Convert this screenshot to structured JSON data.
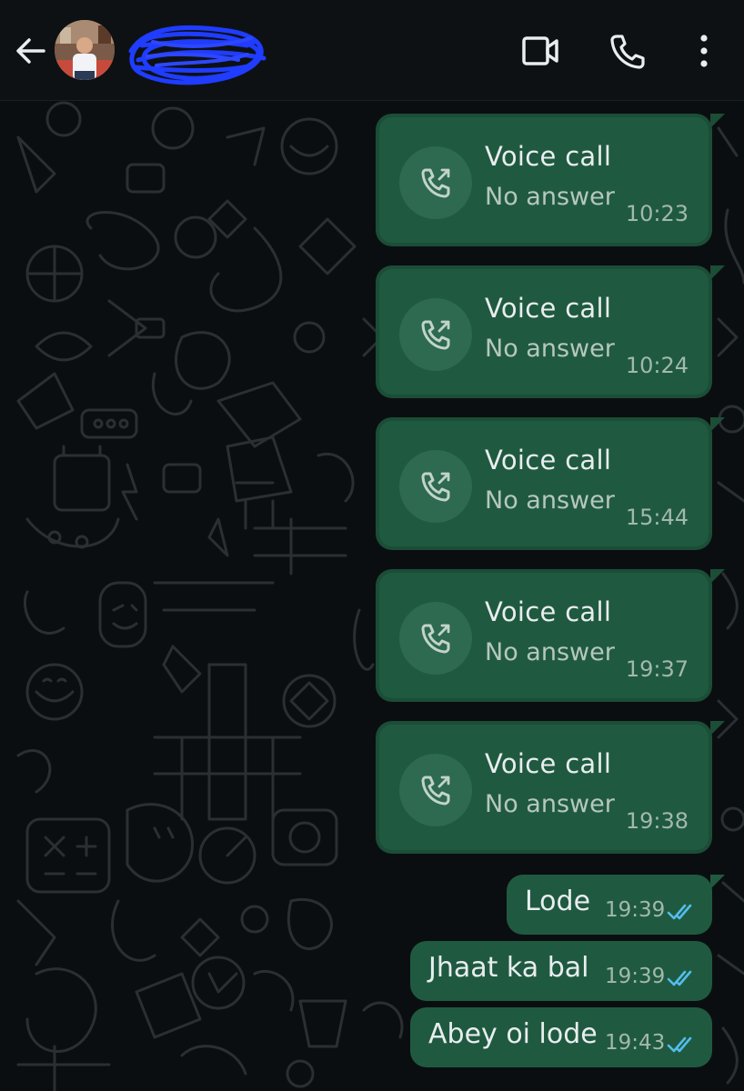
{
  "header": {
    "back_icon": "arrow-left-icon",
    "contact_name": "",
    "video_icon": "video-camera-icon",
    "phone_icon": "phone-icon",
    "menu_icon": "more-vertical-icon"
  },
  "colors": {
    "background": "#0b0e10",
    "header": "#0d1114",
    "outgoing_bubble": "#1f5a40",
    "read_ticks": "#53bdeb",
    "text_primary": "#e9edef",
    "text_secondary": "#a3b8ad"
  },
  "calls": [
    {
      "title": "Voice call",
      "status": "No answer",
      "time": "10:23",
      "icon": "outgoing-call-icon"
    },
    {
      "title": "Voice call",
      "status": "No answer",
      "time": "10:24",
      "icon": "outgoing-call-icon"
    },
    {
      "title": "Voice call",
      "status": "No answer",
      "time": "15:44",
      "icon": "outgoing-call-icon"
    },
    {
      "title": "Voice call",
      "status": "No answer",
      "time": "19:37",
      "icon": "outgoing-call-icon"
    },
    {
      "title": "Voice call",
      "status": "No answer",
      "time": "19:38",
      "icon": "outgoing-call-icon"
    }
  ],
  "messages": [
    {
      "text": "Lode",
      "time": "19:39",
      "status_icon": "double-check-read-icon"
    },
    {
      "text": "Jhaat ka bal",
      "time": "19:39",
      "status_icon": "double-check-read-icon"
    },
    {
      "text": "Abey oi lode",
      "time": "19:43",
      "status_icon": "double-check-read-icon"
    }
  ]
}
